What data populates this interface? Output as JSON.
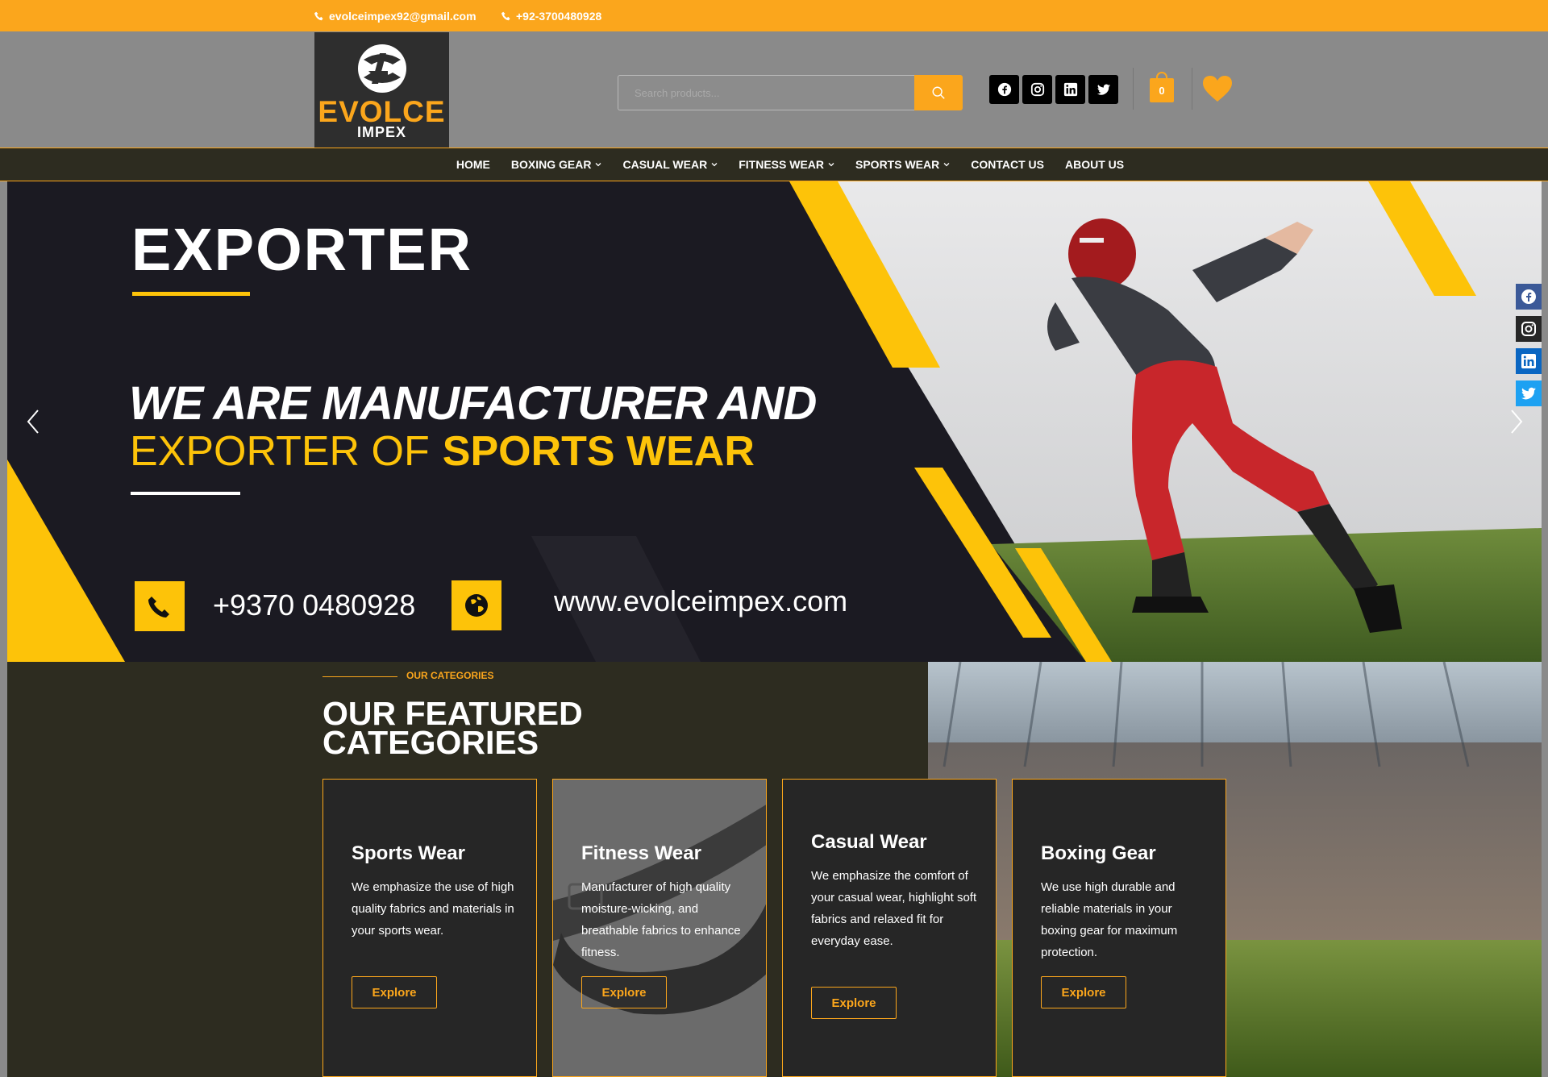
{
  "topbar": {
    "email": "evolceimpex92@gmail.com",
    "phone": "+92-3700480928"
  },
  "logo": {
    "brand": "EVOLCE",
    "sub": "IMPEX"
  },
  "search": {
    "placeholder": "Search products..."
  },
  "social": [
    "facebook-icon",
    "instagram-icon",
    "linkedin-icon",
    "twitter-icon"
  ],
  "cart": {
    "count": "0"
  },
  "nav": {
    "items": [
      {
        "label": "HOME",
        "dropdown": false
      },
      {
        "label": "BOXING GEAR",
        "dropdown": true
      },
      {
        "label": "CASUAL WEAR",
        "dropdown": true
      },
      {
        "label": "FITNESS WEAR",
        "dropdown": true
      },
      {
        "label": "SPORTS WEAR",
        "dropdown": true
      },
      {
        "label": "CONTACT US",
        "dropdown": false
      },
      {
        "label": "ABOUT US",
        "dropdown": false
      }
    ]
  },
  "hero": {
    "heading": "EXPORTER",
    "tagline_line1": "WE ARE MANUFACTURER AND",
    "tagline_line2": "EXPORTER OF",
    "tagline_bold": "SPORTS WEAR",
    "phone": "+9370 0480928",
    "website": "www.evolceimpex.com"
  },
  "categories": {
    "eyebrow": "OUR CATEGORIES",
    "title": "OUR FEATURED CATEGORIES",
    "cards": [
      {
        "title": "Sports Wear",
        "text": "We emphasize the use of high quality fabrics and materials in your sports wear.",
        "button": "Explore"
      },
      {
        "title": "Fitness Wear",
        "text": "Manufacturer of high quality moisture-wicking, and breathable fabrics to enhance fitness.",
        "button": "Explore"
      },
      {
        "title": "Casual Wear",
        "text": "We emphasize the comfort of your casual wear, highlight soft fabrics and relaxed fit for everyday ease.",
        "button": "Explore"
      },
      {
        "title": "Boxing Gear",
        "text": "We use high durable and reliable materials in your boxing gear for maximum protection.",
        "button": "Explore"
      }
    ]
  },
  "colors": {
    "accent": "#fba61c",
    "hero_yellow": "#fdc309",
    "dark": "#2d2c20"
  }
}
